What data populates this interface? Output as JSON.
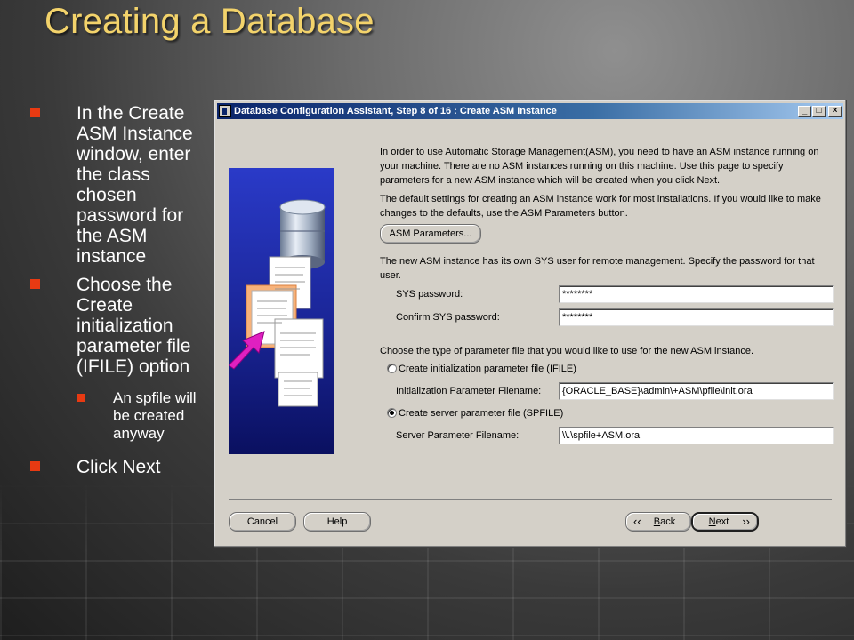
{
  "slide": {
    "title": "Creating a Database",
    "bullets": [
      "In the Create ASM Instance window, enter the class chosen password for the ASM instance",
      "Choose the Create initialization parameter file (IFILE) option",
      "Click Next"
    ],
    "sub_bullets": [
      "An spfile will be created anyway"
    ]
  },
  "window": {
    "title": "Database Configuration Assistant, Step 8 of 16 : Create ASM Instance",
    "controls": {
      "minimize": "_",
      "maximize": "□",
      "close": "×"
    },
    "intro": "In order to use Automatic Storage Management(ASM), you need to have an ASM instance running on your machine. There are no ASM instances running on this machine. Use this page to specify parameters for a new ASM instance which will be created when you click Next.",
    "defaults_text": "The default settings for creating an ASM instance work for most installations. If you would like to make changes to the defaults, use the ASM Parameters button.",
    "asm_params_button": "ASM Parameters...",
    "sys_user_text": "The new ASM instance has its own SYS user for remote management. Specify the password for that user.",
    "sys_password_label": "SYS password:",
    "sys_password_value": "********",
    "confirm_password_label": "Confirm SYS password:",
    "confirm_password_value": "********",
    "param_file_text": "Choose the type of parameter file that you would like to use for the new ASM instance.",
    "ifile_option": "Create initialization parameter file (IFILE)",
    "ifile_label": "Initialization Parameter Filename:",
    "ifile_value": "{ORACLE_BASE}\\admin\\+ASM\\pfile\\init.ora",
    "spfile_option": "Create server parameter file (SPFILE)",
    "spfile_label": "Server Parameter Filename:",
    "spfile_value": "\\\\.\\spfile+ASM.ora",
    "selected_option": "spfile",
    "buttons": {
      "cancel": "Cancel",
      "help": "Help",
      "back_mnemonic": "B",
      "back_rest": "ack",
      "next_mnemonic": "N",
      "next_rest": "ext"
    }
  },
  "colors": {
    "title": "#f3d36b",
    "bullet": "#e83a12",
    "titlebar_start": "#0a246a",
    "titlebar_end": "#a6caf0",
    "dialog_face": "#d4d0c8"
  },
  "icons": [
    "database-cylinder-icon",
    "document-stack-icon",
    "magenta-arrow-icon",
    "chevron-left-icon",
    "chevron-right-icon"
  ]
}
